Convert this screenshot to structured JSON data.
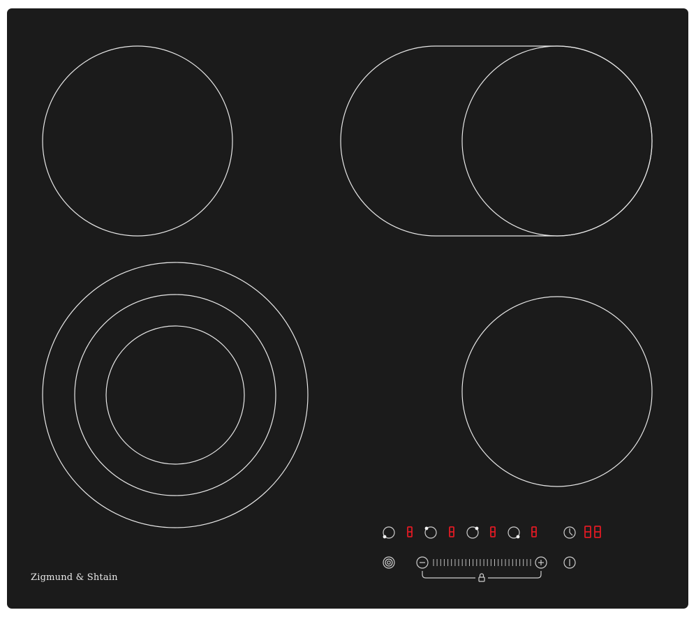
{
  "brand": {
    "name": "Zigmund & Shtain"
  },
  "colors": {
    "glass": "#1b1b1b",
    "ring": "#e8e8e8",
    "display": "#e01a24",
    "controls": "#cfcfcf"
  },
  "zones": [
    {
      "id": "rear-left",
      "type": "single"
    },
    {
      "id": "rear-right",
      "type": "oval-extension"
    },
    {
      "id": "front-left",
      "type": "triple-ring"
    },
    {
      "id": "front-right",
      "type": "single"
    }
  ],
  "controls": {
    "zone_selectors": [
      {
        "icon": "zone-front-left-icon",
        "display": "8"
      },
      {
        "icon": "zone-rear-left-icon",
        "display": "8"
      },
      {
        "icon": "zone-rear-right-icon",
        "display": "8"
      },
      {
        "icon": "zone-front-right-icon",
        "display": "8"
      }
    ],
    "timer": {
      "icon": "clock-icon",
      "display": "88"
    },
    "extension_icon": "dual-ring-icon",
    "minus_icon": "minus-icon",
    "plus_icon": "plus-icon",
    "lock_icon": "lock-icon",
    "power_icon": "power-icon"
  }
}
